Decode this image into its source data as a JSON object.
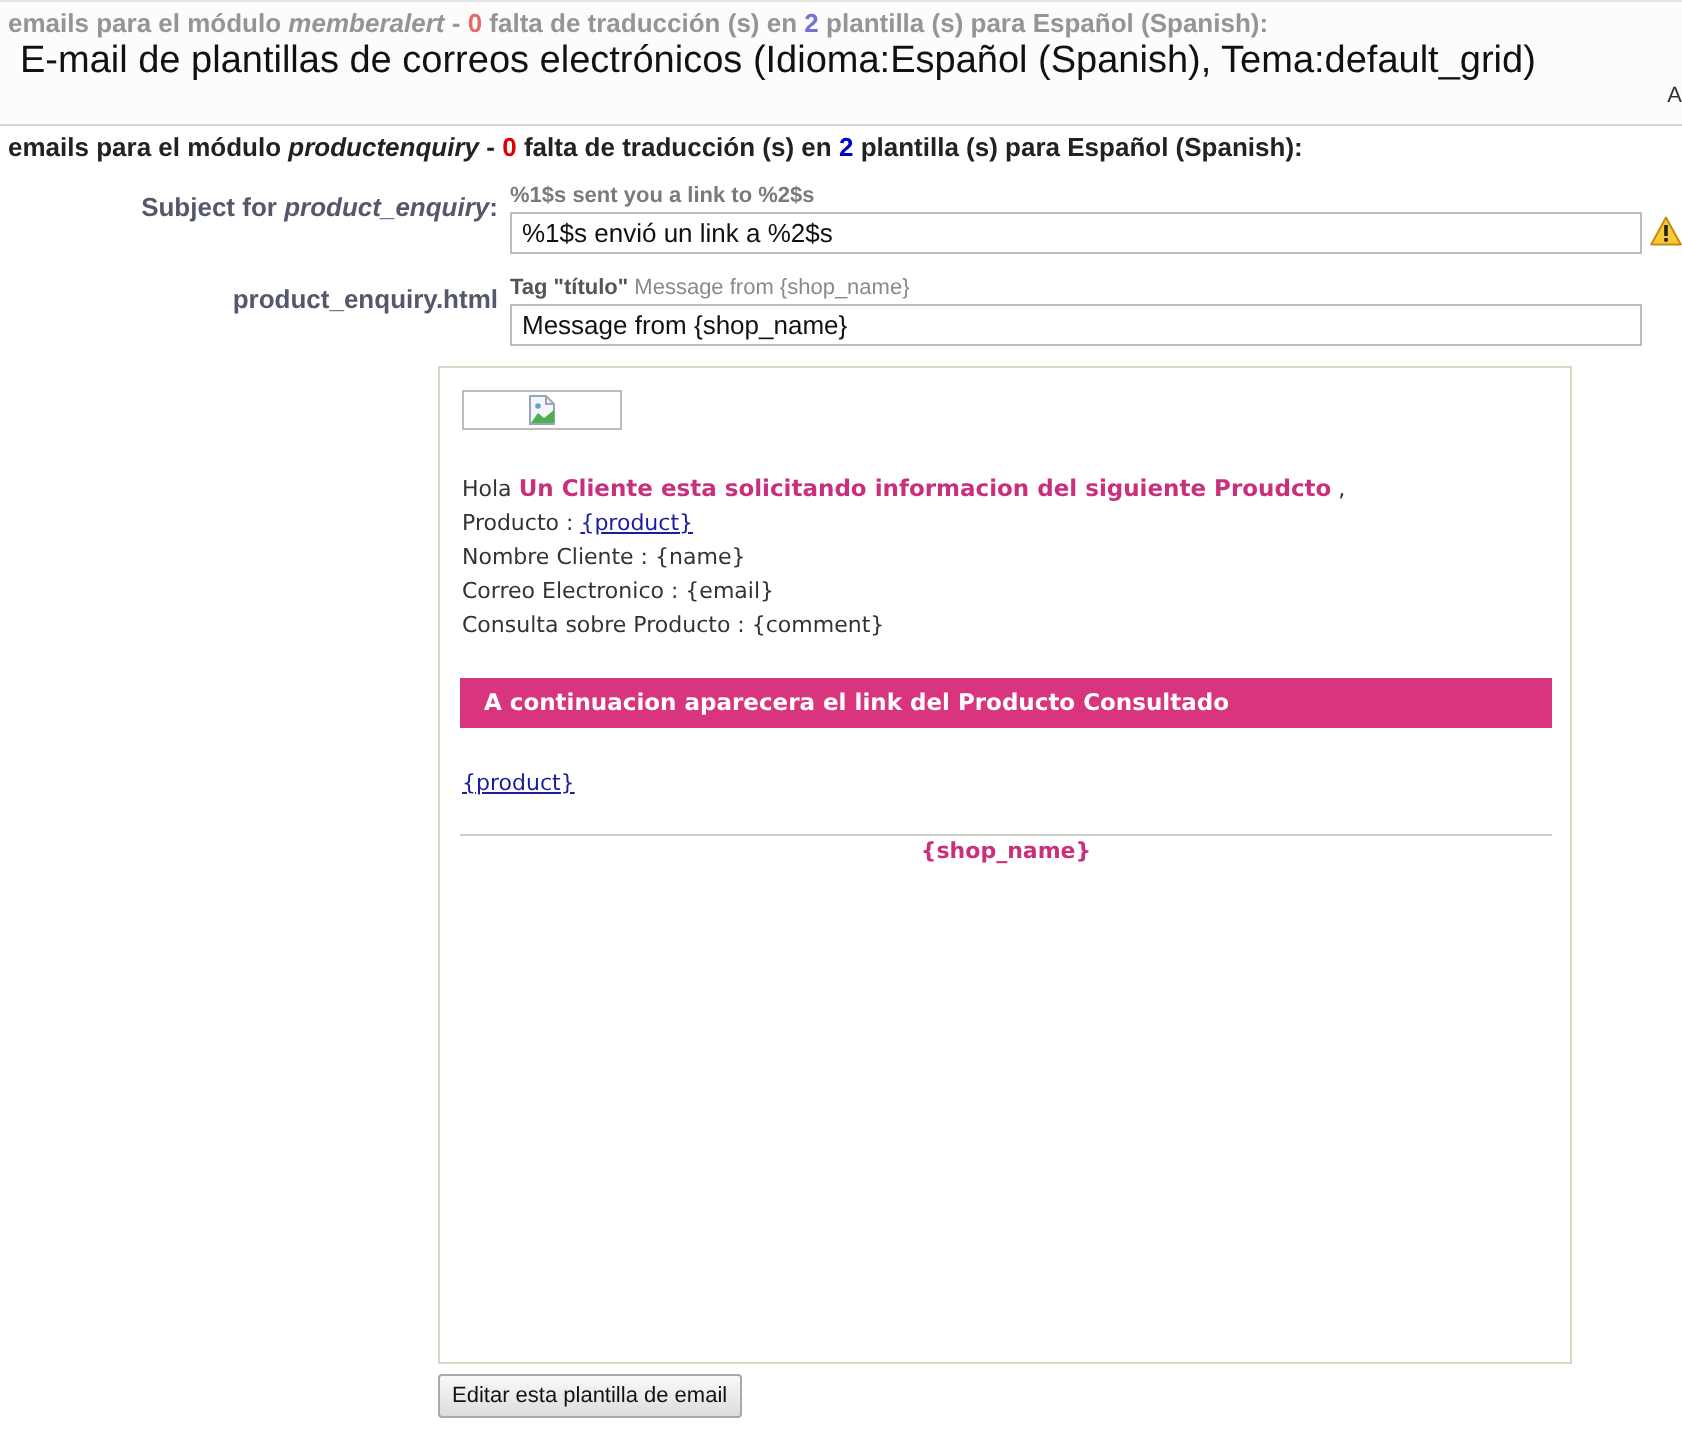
{
  "header": {
    "background_heading": {
      "dimmed": true,
      "segments": [
        {
          "kind": "plain",
          "text": "emails para el módulo"
        },
        {
          "kind": "italic",
          "text": "memberalert"
        },
        {
          "kind": "plain",
          "text": "-"
        },
        {
          "kind": "missing",
          "text": "0"
        },
        {
          "kind": "plain",
          "text": "falta de traducción (s) en"
        },
        {
          "kind": "templates",
          "text": "2"
        },
        {
          "kind": "plain",
          "text": "plantilla (s) para Español (Spanish):"
        }
      ]
    },
    "title": "E-mail de plantillas de correos electrónicos (Idioma:Español (Spanish), Tema:default_grid)",
    "edge_text": "A"
  },
  "module_heading": {
    "dimmed": false,
    "segments": [
      {
        "kind": "plain",
        "text": "emails para el módulo"
      },
      {
        "kind": "italic",
        "text": "productenquiry"
      },
      {
        "kind": "plain",
        "text": "-"
      },
      {
        "kind": "missing",
        "text": "0"
      },
      {
        "kind": "plain",
        "text": "falta de traducción (s) en"
      },
      {
        "kind": "templates",
        "text": "2"
      },
      {
        "kind": "plain",
        "text": "plantilla (s) para Español (Spanish):"
      }
    ]
  },
  "fields": [
    {
      "kind": "subject",
      "label": "Subject for *product_enquiry*:",
      "hint": "%1$s sent you a link to %2$s",
      "value": "%1$s envió un link a %2$s",
      "warning": true
    },
    {
      "kind": "template",
      "label": "product_enquiry.html",
      "hint": "**Tag \"título\"** Message from {shop_name}",
      "value": "Message from {shop_name}",
      "warning": false
    }
  ],
  "preview": {
    "greeting": {
      "word": "Hola",
      "highlight": "Un Cliente esta solicitando informacion del siguiente Proudcto",
      "end": ","
    },
    "details": [
      {
        "kind": "link",
        "label": "Producto :",
        "value": "{product}"
      },
      {
        "kind": "text",
        "label": "Nombre Cliente :",
        "value": "{name}"
      },
      {
        "kind": "text",
        "label": "Correo Electronico :",
        "value": "{email}"
      },
      {
        "kind": "text",
        "label": "Consulta sobre Producto :",
        "value": "{comment}"
      }
    ],
    "banner": "A continuacion aparecera el link del Producto Consultado",
    "product_link": "{product}",
    "footer": "{shop_name}"
  },
  "edit_button": "Editar esta plantilla de email"
}
